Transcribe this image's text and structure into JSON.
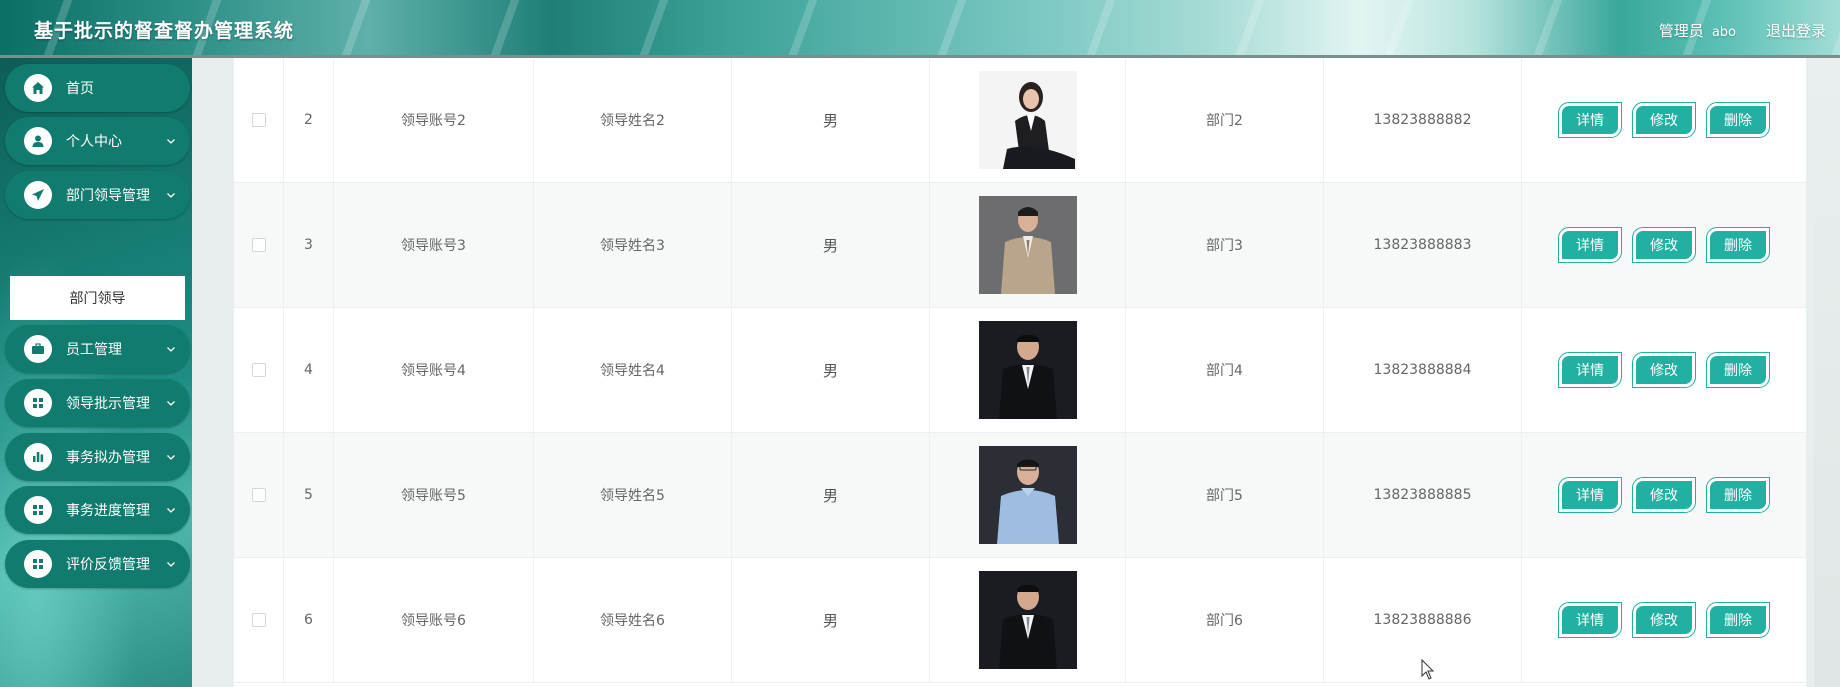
{
  "header": {
    "title": "基于批示的督查督办管理系统",
    "role": "管理员",
    "username": "abo",
    "logout": "退出登录"
  },
  "sidebar": {
    "items": [
      {
        "label": "首页",
        "icon": "home-icon",
        "has_arrow": false
      },
      {
        "label": "个人中心",
        "icon": "user-icon",
        "has_arrow": true
      },
      {
        "label": "部门领导管理",
        "icon": "paper-plane-icon",
        "has_arrow": true
      },
      {
        "label": "员工管理",
        "icon": "briefcase-icon",
        "has_arrow": true
      },
      {
        "label": "领导批示管理",
        "icon": "grid-icon",
        "has_arrow": true
      },
      {
        "label": "事务拟办管理",
        "icon": "bar-chart-icon",
        "has_arrow": true
      },
      {
        "label": "事务进度管理",
        "icon": "grid-icon",
        "has_arrow": true
      },
      {
        "label": "评价反馈管理",
        "icon": "grid-icon",
        "has_arrow": true
      }
    ],
    "active_submenu": "部门领导"
  },
  "table": {
    "rows": [
      {
        "index": "2",
        "account": "领导账号2",
        "name": "领导姓名2",
        "sex": "男",
        "dept": "部门2",
        "phone": "13823888882",
        "photo": "woman-suit"
      },
      {
        "index": "3",
        "account": "领导账号3",
        "name": "领导姓名3",
        "sex": "男",
        "dept": "部门3",
        "phone": "13823888883",
        "photo": "man-beige-suit"
      },
      {
        "index": "4",
        "account": "领导账号4",
        "name": "领导姓名4",
        "sex": "男",
        "dept": "部门4",
        "phone": "13823888884",
        "photo": "man-dark-suit"
      },
      {
        "index": "5",
        "account": "领导账号5",
        "name": "领导姓名5",
        "sex": "男",
        "dept": "部门5",
        "phone": "13823888885",
        "photo": "man-blue-shirt"
      },
      {
        "index": "6",
        "account": "领导账号6",
        "name": "领导姓名6",
        "sex": "男",
        "dept": "部门6",
        "phone": "13823888886",
        "photo": "man-dark-suit"
      }
    ],
    "actions": {
      "detail": "详情",
      "edit": "修改",
      "delete": "删除"
    }
  },
  "colors": {
    "accent": "#22b0a2",
    "menu_bg": "#127b70",
    "sidebar_bg": "#157a72"
  }
}
